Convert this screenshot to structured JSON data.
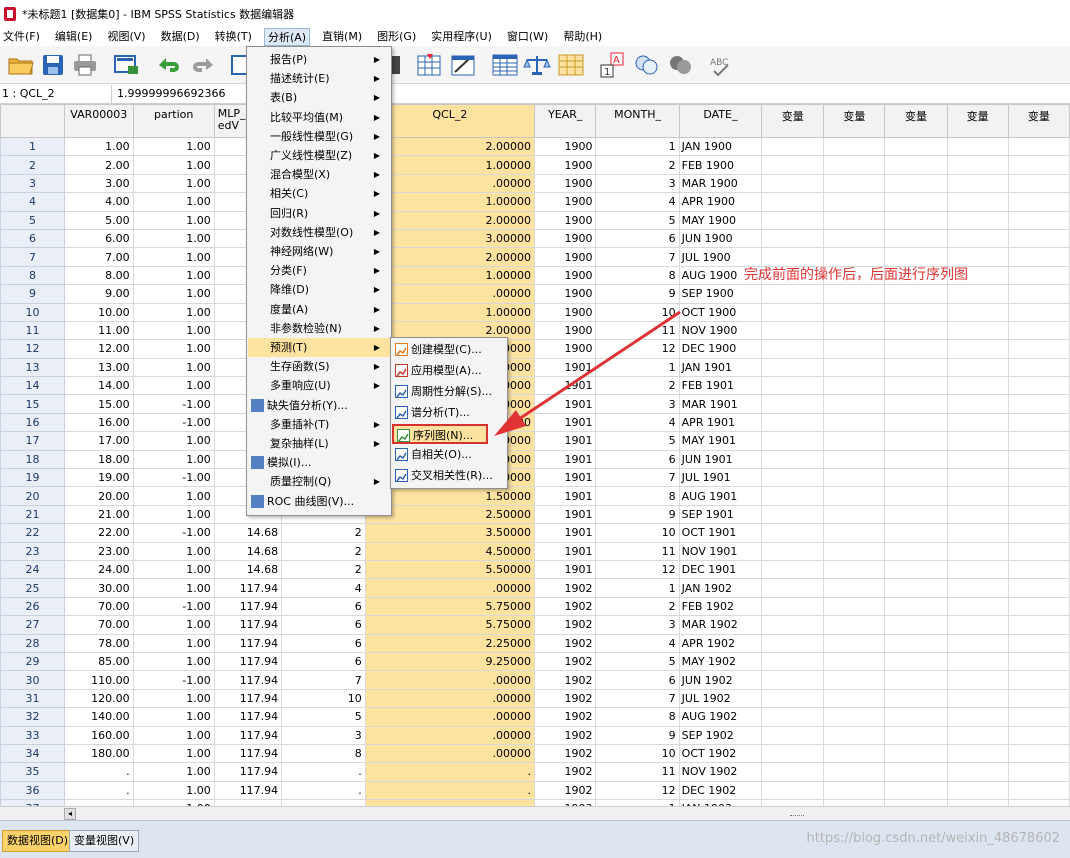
{
  "window": {
    "title": "*未标题1 [数据集0] - IBM SPSS Statistics 数据编辑器"
  },
  "menubar": [
    "文件(F)",
    "编辑(E)",
    "视图(V)",
    "数据(D)",
    "转换(T)",
    "分析(A)",
    "直销(M)",
    "图形(G)",
    "实用程序(U)",
    "窗口(W)",
    "帮助(H)"
  ],
  "cellbar": {
    "ref": "1 : QCL_2",
    "value": "1.99999996692366"
  },
  "columns": [
    "VAR00003",
    "partion",
    "MLP_",
    "",
    "QCL_2",
    "YEAR_",
    "MONTH_",
    "DATE_",
    "变量",
    "变量",
    "变量",
    "变量",
    "变量"
  ],
  "mlp_sub": "edV",
  "rows": [
    [
      "1",
      "1.00",
      "1.00",
      "",
      "",
      "2.00000",
      "1900",
      "1",
      "JAN 1900"
    ],
    [
      "2",
      "2.00",
      "1.00",
      "",
      "",
      "1.00000",
      "1900",
      "2",
      "FEB 1900"
    ],
    [
      "3",
      "3.00",
      "1.00",
      "",
      "",
      ".00000",
      "1900",
      "3",
      "MAR 1900"
    ],
    [
      "4",
      "4.00",
      "1.00",
      "",
      "",
      "1.00000",
      "1900",
      "4",
      "APR 1900"
    ],
    [
      "5",
      "5.00",
      "1.00",
      "",
      "",
      "2.00000",
      "1900",
      "5",
      "MAY 1900"
    ],
    [
      "6",
      "6.00",
      "1.00",
      "",
      "",
      "3.00000",
      "1900",
      "6",
      "JUN 1900"
    ],
    [
      "7",
      "7.00",
      "1.00",
      "",
      "",
      "2.00000",
      "1900",
      "7",
      "JUL 1900"
    ],
    [
      "8",
      "8.00",
      "1.00",
      "",
      "",
      "1.00000",
      "1900",
      "8",
      "AUG 1900"
    ],
    [
      "9",
      "9.00",
      "1.00",
      "",
      "",
      ".00000",
      "1900",
      "9",
      "SEP 1900"
    ],
    [
      "10",
      "10.00",
      "1.00",
      "",
      "",
      "1.00000",
      "1900",
      "10",
      "OCT 1900"
    ],
    [
      "11",
      "11.00",
      "1.00",
      "",
      "",
      "2.00000",
      "1900",
      "11",
      "NOV 1900"
    ],
    [
      "12",
      "12.00",
      "1.00",
      "",
      "",
      "",
      "1900",
      "12",
      "DEC 1900"
    ],
    [
      "13",
      "13.00",
      "1.00",
      "",
      "",
      "",
      "1901",
      "1",
      "JAN 1901"
    ],
    [
      "14",
      "14.00",
      "1.00",
      "",
      "",
      "",
      "1901",
      "2",
      "FEB 1901"
    ],
    [
      "15",
      "15.00",
      "-1.00",
      "",
      "",
      "",
      "1901",
      "3",
      "MAR 1901"
    ],
    [
      "16",
      "16.00",
      "-1.00",
      "",
      "",
      "",
      "1901",
      "4",
      "APR 1901"
    ],
    [
      "17",
      "17.00",
      "1.00",
      "",
      "",
      "",
      "1901",
      "5",
      "MAY 1901"
    ],
    [
      "18",
      "18.00",
      "1.00",
      "",
      "",
      "",
      "1901",
      "6",
      "JUN 1901"
    ],
    [
      "19",
      "19.00",
      "-1.00",
      "",
      "",
      "",
      "1901",
      "7",
      "JUL 1901"
    ],
    [
      "20",
      "20.00",
      "1.00",
      "",
      "",
      "1.50000",
      "1901",
      "8",
      "AUG 1901"
    ],
    [
      "21",
      "21.00",
      "1.00",
      "",
      "",
      "2.50000",
      "1901",
      "9",
      "SEP 1901"
    ],
    [
      "22",
      "22.00",
      "-1.00",
      "14.68",
      "2",
      "3.50000",
      "1901",
      "10",
      "OCT 1901"
    ],
    [
      "23",
      "23.00",
      "1.00",
      "14.68",
      "2",
      "4.50000",
      "1901",
      "11",
      "NOV 1901"
    ],
    [
      "24",
      "24.00",
      "1.00",
      "14.68",
      "2",
      "5.50000",
      "1901",
      "12",
      "DEC 1901"
    ],
    [
      "25",
      "30.00",
      "1.00",
      "117.94",
      "4",
      ".00000",
      "1902",
      "1",
      "JAN 1902"
    ],
    [
      "26",
      "70.00",
      "-1.00",
      "117.94",
      "6",
      "5.75000",
      "1902",
      "2",
      "FEB 1902"
    ],
    [
      "27",
      "70.00",
      "1.00",
      "117.94",
      "6",
      "5.75000",
      "1902",
      "3",
      "MAR 1902"
    ],
    [
      "28",
      "78.00",
      "1.00",
      "117.94",
      "6",
      "2.25000",
      "1902",
      "4",
      "APR 1902"
    ],
    [
      "29",
      "85.00",
      "1.00",
      "117.94",
      "6",
      "9.25000",
      "1902",
      "5",
      "MAY 1902"
    ],
    [
      "30",
      "110.00",
      "-1.00",
      "117.94",
      "7",
      ".00000",
      "1902",
      "6",
      "JUN 1902"
    ],
    [
      "31",
      "120.00",
      "1.00",
      "117.94",
      "10",
      ".00000",
      "1902",
      "7",
      "JUL 1902"
    ],
    [
      "32",
      "140.00",
      "1.00",
      "117.94",
      "5",
      ".00000",
      "1902",
      "8",
      "AUG 1902"
    ],
    [
      "33",
      "160.00",
      "1.00",
      "117.94",
      "3",
      ".00000",
      "1902",
      "9",
      "SEP 1902"
    ],
    [
      "34",
      "180.00",
      "1.00",
      "117.94",
      "8",
      ".00000",
      "1902",
      "10",
      "OCT 1902"
    ],
    [
      "35",
      ".",
      "1.00",
      "117.94",
      ".",
      ".",
      "1902",
      "11",
      "NOV 1902"
    ],
    [
      "36",
      ".",
      "1.00",
      "117.94",
      ".",
      ".",
      "1902",
      "12",
      "DEC 1902"
    ],
    [
      "37",
      "",
      "1.00",
      "",
      "",
      "",
      "1903",
      "1",
      "JAN 1903"
    ]
  ],
  "qcl_partial": {
    "r12": ".00000",
    "r13": ".50000",
    "r14": ".50000",
    "r15": ".50000",
    "r16": ".50000",
    "r17": ".50000",
    "r18": ".50000",
    "r19": ".50000",
    "r21_part": "2"
  },
  "analyze_menu": [
    {
      "label": "报告(P)",
      "sub": true
    },
    {
      "label": "描述统计(E)",
      "sub": true
    },
    {
      "label": "表(B)",
      "sub": true
    },
    {
      "label": "比较平均值(M)",
      "sub": true
    },
    {
      "label": "一般线性模型(G)",
      "sub": true
    },
    {
      "label": "广义线性模型(Z)",
      "sub": true
    },
    {
      "label": "混合模型(X)",
      "sub": true
    },
    {
      "label": "相关(C)",
      "sub": true
    },
    {
      "label": "回归(R)",
      "sub": true
    },
    {
      "label": "对数线性模型(O)",
      "sub": true
    },
    {
      "label": "神经网络(W)",
      "sub": true
    },
    {
      "label": "分类(F)",
      "sub": true
    },
    {
      "label": "降维(D)",
      "sub": true
    },
    {
      "label": "度量(A)",
      "sub": true
    },
    {
      "label": "非参数检验(N)",
      "sub": true
    },
    {
      "label": "预测(T)",
      "sub": true,
      "hover": true
    },
    {
      "label": "生存函数(S)",
      "sub": true
    },
    {
      "label": "多重响应(U)",
      "sub": true
    },
    {
      "label": "缺失值分析(Y)...",
      "sub": false,
      "icon": true
    },
    {
      "label": "多重插补(T)",
      "sub": true
    },
    {
      "label": "复杂抽样(L)",
      "sub": true
    },
    {
      "label": "模拟(I)...",
      "sub": false,
      "icon": true
    },
    {
      "label": "质量控制(Q)",
      "sub": true
    },
    {
      "label": "ROC 曲线图(V)...",
      "sub": false,
      "icon": true
    }
  ],
  "forecast_menu": [
    {
      "label": "创建模型(C)..."
    },
    {
      "label": "应用模型(A)..."
    },
    {
      "label": "周期性分解(S)..."
    },
    {
      "label": "谱分析(T)..."
    },
    {
      "label": "序列图(N)...",
      "hover": true
    },
    {
      "label": "自相关(O)..."
    },
    {
      "label": "交叉相关性(R)..."
    }
  ],
  "annotation": "完成前面的操作后，后面进行序列图",
  "tabs": {
    "data_view": "数据视图(D)",
    "variable_view": "变量视图(V)"
  },
  "watermark": "https://blog.csdn.net/weixin_48678602",
  "colors": {
    "highlight": "#fde2a0",
    "annotation": "#e03434",
    "tab_active": "#fcd26b"
  }
}
